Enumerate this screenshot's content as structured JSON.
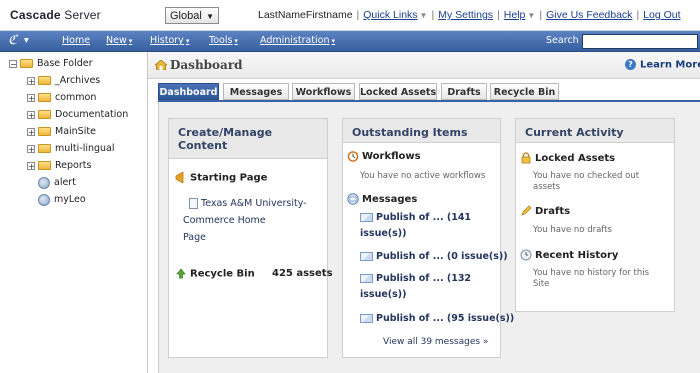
{
  "brand": {
    "primary": "Cascade",
    "secondary": " Server"
  },
  "site_select": {
    "value": "Global"
  },
  "top_links": {
    "user": "LastNameFirstname",
    "quick_links": "Quick Links",
    "my_settings": "My Settings",
    "help": "Help",
    "feedback": "Give Us Feedback",
    "logout": "Log Out"
  },
  "nav": {
    "home": "Home",
    "new": "New",
    "history": "History",
    "tools": "Tools",
    "administration": "Administration",
    "search_label": "Search"
  },
  "tree": {
    "root": "Base Folder",
    "items": [
      "_Archives",
      "common",
      "Documentation",
      "MainSite",
      "multi-lingual",
      "Reports"
    ],
    "pages": [
      "alert",
      "myLeo"
    ]
  },
  "header": {
    "title": "Dashboard",
    "learn_more": "Learn More"
  },
  "tabs": [
    "Dashboard",
    "Messages",
    "Workflows",
    "Locked Assets",
    "Drafts",
    "Recycle Bin"
  ],
  "create_panel": {
    "title_line1": "Create/Manage",
    "title_line2": "Content",
    "starting_page_label": "Starting Page",
    "starting_page_line1": "Texas A&M University-",
    "starting_page_line2": "Commerce Home",
    "starting_page_line3": "Page",
    "recycle_bin_label": "Recycle Bin",
    "recycle_bin_count": "425 assets"
  },
  "outstanding_panel": {
    "title": "Outstanding Items",
    "workflows_label": "Workflows",
    "workflows_note": "You have no active workflows",
    "messages_label": "Messages",
    "messages": [
      {
        "line1": "Publish of ... (141",
        "line2": "issue(s))"
      },
      {
        "line1": "Publish of ... (0 issue(s))",
        "line2": ""
      },
      {
        "line1": "Publish of ... (132",
        "line2": "issue(s))"
      },
      {
        "line1": "Publish of ... (95 issue(s))",
        "line2": ""
      }
    ],
    "view_all": "View all 39 messages »"
  },
  "activity_panel": {
    "title": "Current Activity",
    "locked_label": "Locked Assets",
    "locked_note_line1": "You have no checked out",
    "locked_note_line2": "assets",
    "drafts_label": "Drafts",
    "drafts_note": "You have no drafts",
    "history_label": "Recent History",
    "history_note_line1": "You have no history for this",
    "history_note_line2": "Site"
  },
  "colors": {
    "nav_bar": "#36609f",
    "active_tab": "#3a62a5",
    "link": "#1a3f8f"
  }
}
